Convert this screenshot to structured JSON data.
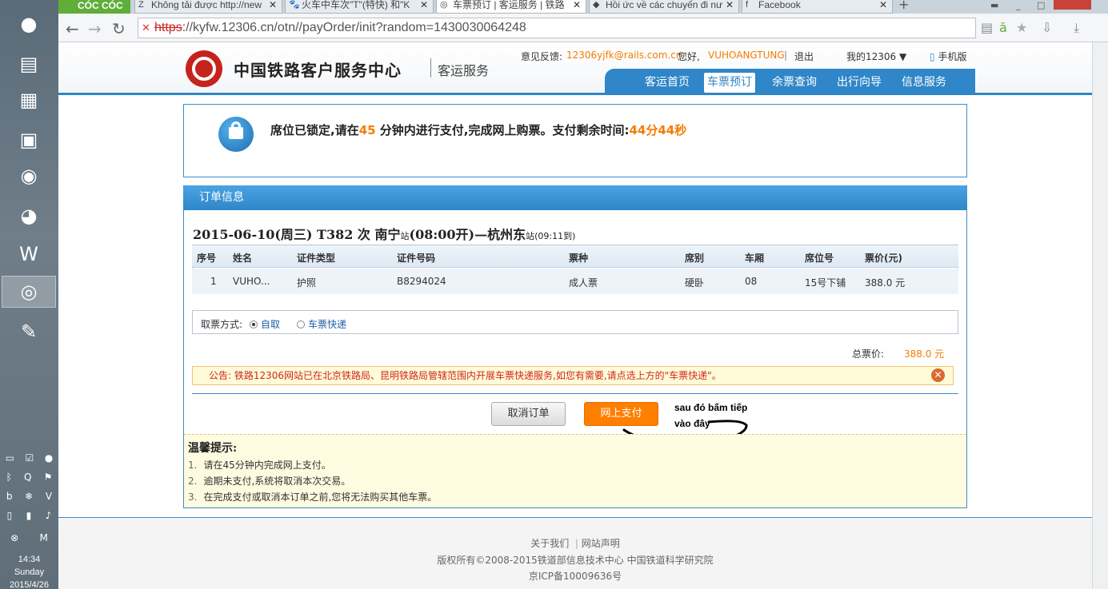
{
  "browser": {
    "brand": "CÓC CÓC",
    "tabs": [
      {
        "title": "Không tải được http://new",
        "fav": "Z"
      },
      {
        "title": "火车中车次\"T\"(特快) 和\"K",
        "fav": "🐾"
      },
      {
        "title": "车票预订 | 客运服务 | 铁路",
        "fav": "◎"
      },
      {
        "title": "Hồi ức về các chuyến đi nư",
        "fav": "◆"
      },
      {
        "title": "Facebook",
        "fav": "f"
      }
    ],
    "url_scheme": "https",
    "url_rest": "://kyfw.12306.cn/otn//payOrder/init?random=1430030064248"
  },
  "header": {
    "site_title": "中国铁路客户服务中心",
    "site_sub": "客运服务",
    "feedback_label": "意见反馈:",
    "feedback_email": "12306yjfk@rails.com.cn",
    "greeting": "您好,",
    "username": "VUHOANGTUNG",
    "logout": "退出",
    "my12306": "我的12306",
    "mobile": "手机版",
    "nav": [
      "客运首页",
      "车票预订",
      "余票查询",
      "出行向导",
      "信息服务"
    ]
  },
  "lock": {
    "text_pre": "席位已锁定,请在",
    "minutes": "45",
    "text_mid": " 分钟内进行支付,完成网上购票。支付剩余时间:",
    "remaining": "44分44秒"
  },
  "order": {
    "panel_title": "订单信息",
    "trip_main": "2015-06-10(周三)  T382 次  南宁",
    "trip_station_suffix": "站",
    "trip_depart": "(08:00开)—杭州东",
    "trip_arrive": "(09:11到)",
    "columns": [
      "序号",
      "姓名",
      "证件类型",
      "证件号码",
      "票种",
      "席别",
      "车厢",
      "席位号",
      "票价(元)"
    ],
    "row": [
      "1",
      "VUHO...",
      "护照",
      "B8294024",
      "成人票",
      "硬卧",
      "08",
      "15号下铺",
      "388.0 元"
    ],
    "pickup_label": "取票方式:",
    "pickup_self": "自取",
    "pickup_express": "车票快递",
    "total_label": "总票价:",
    "total_value": "388.0 元",
    "notice": "公告:  铁路12306网站已在北京铁路局、昆明铁路局管辖范围内开展车票快递服务,如您有需要,请点选上方的\"车票快递\"。",
    "cancel_label": "取消订单",
    "pay_label": "网上支付",
    "annotation_line1": "sau đó bấm tiếp",
    "annotation_line2": "vào đây"
  },
  "tips": {
    "title": "温馨提示:",
    "items": [
      "请在45分钟内完成网上支付。",
      "逾期未支付,系统将取消本次交易。",
      "在完成支付或取消本订单之前,您将无法购买其他车票。"
    ]
  },
  "footer": {
    "about": "关于我们",
    "statement": "网站声明",
    "copyright": "版权所有©2008-2015铁道部信息技术中心   中国铁道科学研究院",
    "icp": "京ICP备10009636号"
  },
  "system": {
    "time": "14:34",
    "day": "Sunday",
    "date": "2015/4/26"
  },
  "colors": {
    "accent": "#2f86c8",
    "orange": "#ff7f00",
    "notice_red": "#d0281c"
  }
}
